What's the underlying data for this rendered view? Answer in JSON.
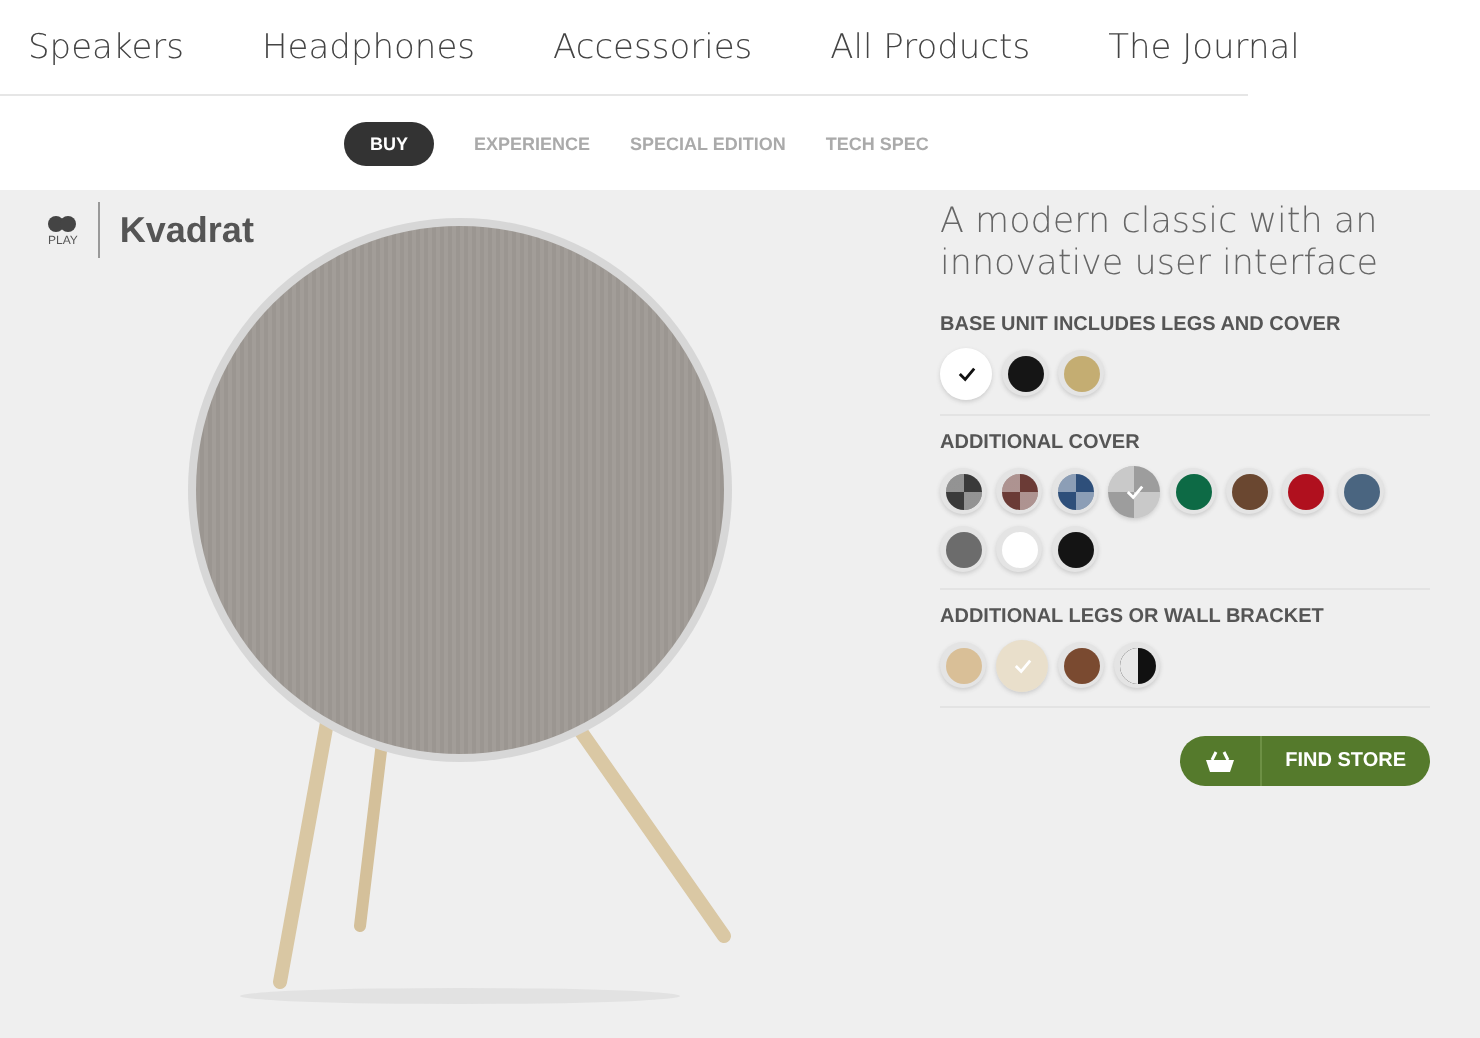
{
  "nav": {
    "items": [
      {
        "label": "Speakers"
      },
      {
        "label": "Headphones"
      },
      {
        "label": "Accessories"
      },
      {
        "label": "All Products"
      },
      {
        "label": "The Journal"
      }
    ]
  },
  "subnav": {
    "tabs": [
      {
        "label": "BUY",
        "selected": true
      },
      {
        "label": "EXPERIENCE",
        "selected": false
      },
      {
        "label": "SPECIAL EDITION",
        "selected": false
      },
      {
        "label": "TECH SPEC",
        "selected": false
      }
    ]
  },
  "logo": {
    "badge": "PLAY",
    "brand": "Kvadrat"
  },
  "product": {
    "tagline": "A modern classic with an innovative user interface",
    "groups": [
      {
        "title": "BASE UNIT INCLUDES LEGS AND COVER",
        "swatches": [
          {
            "kind": "solid",
            "color": "#ffffff",
            "selected": true
          },
          {
            "kind": "solid",
            "color": "#151515",
            "selected": false
          },
          {
            "kind": "solid",
            "color": "#c4ad72",
            "selected": false
          }
        ]
      },
      {
        "title": "ADDITIONAL COVER",
        "swatches": [
          {
            "kind": "quartered",
            "color": "#3a3a3a",
            "selected": false
          },
          {
            "kind": "quartered",
            "color": "#6b3b36",
            "selected": false
          },
          {
            "kind": "quartered",
            "color": "#2e4f7a",
            "selected": false
          },
          {
            "kind": "quartered",
            "color": "#9d9d9d",
            "selected": true
          },
          {
            "kind": "solid",
            "color": "#0d6a45",
            "selected": false
          },
          {
            "kind": "solid",
            "color": "#6a4730",
            "selected": false
          },
          {
            "kind": "solid",
            "color": "#b0101e",
            "selected": false
          },
          {
            "kind": "solid",
            "color": "#4a6580",
            "selected": false
          },
          {
            "kind": "solid",
            "color": "#6c6c6c",
            "selected": false
          },
          {
            "kind": "solid",
            "color": "#ffffff",
            "selected": false
          },
          {
            "kind": "solid",
            "color": "#141414",
            "selected": false
          }
        ]
      },
      {
        "title": "ADDITIONAL LEGS OR WALL BRACKET",
        "swatches": [
          {
            "kind": "solid",
            "color": "#d9bf97",
            "selected": false
          },
          {
            "kind": "solid",
            "color": "#e9dfcb",
            "selected": true
          },
          {
            "kind": "solid",
            "color": "#7a4a30",
            "selected": false
          },
          {
            "kind": "halved",
            "color": "#111111",
            "selected": false
          }
        ]
      }
    ],
    "cta": {
      "label": "FIND STORE"
    }
  }
}
